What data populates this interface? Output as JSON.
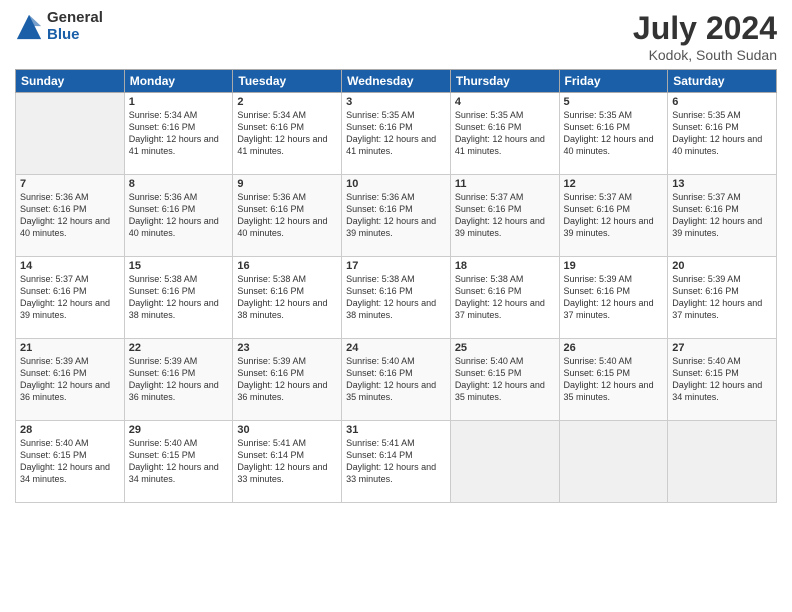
{
  "logo": {
    "general": "General",
    "blue": "Blue"
  },
  "title": "July 2024",
  "location": "Kodok, South Sudan",
  "days_of_week": [
    "Sunday",
    "Monday",
    "Tuesday",
    "Wednesday",
    "Thursday",
    "Friday",
    "Saturday"
  ],
  "weeks": [
    [
      {
        "day": "",
        "sunrise": "",
        "sunset": "",
        "daylight": ""
      },
      {
        "day": "1",
        "sunrise": "Sunrise: 5:34 AM",
        "sunset": "Sunset: 6:16 PM",
        "daylight": "Daylight: 12 hours and 41 minutes."
      },
      {
        "day": "2",
        "sunrise": "Sunrise: 5:34 AM",
        "sunset": "Sunset: 6:16 PM",
        "daylight": "Daylight: 12 hours and 41 minutes."
      },
      {
        "day": "3",
        "sunrise": "Sunrise: 5:35 AM",
        "sunset": "Sunset: 6:16 PM",
        "daylight": "Daylight: 12 hours and 41 minutes."
      },
      {
        "day": "4",
        "sunrise": "Sunrise: 5:35 AM",
        "sunset": "Sunset: 6:16 PM",
        "daylight": "Daylight: 12 hours and 41 minutes."
      },
      {
        "day": "5",
        "sunrise": "Sunrise: 5:35 AM",
        "sunset": "Sunset: 6:16 PM",
        "daylight": "Daylight: 12 hours and 40 minutes."
      },
      {
        "day": "6",
        "sunrise": "Sunrise: 5:35 AM",
        "sunset": "Sunset: 6:16 PM",
        "daylight": "Daylight: 12 hours and 40 minutes."
      }
    ],
    [
      {
        "day": "7",
        "sunrise": "Sunrise: 5:36 AM",
        "sunset": "Sunset: 6:16 PM",
        "daylight": "Daylight: 12 hours and 40 minutes."
      },
      {
        "day": "8",
        "sunrise": "Sunrise: 5:36 AM",
        "sunset": "Sunset: 6:16 PM",
        "daylight": "Daylight: 12 hours and 40 minutes."
      },
      {
        "day": "9",
        "sunrise": "Sunrise: 5:36 AM",
        "sunset": "Sunset: 6:16 PM",
        "daylight": "Daylight: 12 hours and 40 minutes."
      },
      {
        "day": "10",
        "sunrise": "Sunrise: 5:36 AM",
        "sunset": "Sunset: 6:16 PM",
        "daylight": "Daylight: 12 hours and 39 minutes."
      },
      {
        "day": "11",
        "sunrise": "Sunrise: 5:37 AM",
        "sunset": "Sunset: 6:16 PM",
        "daylight": "Daylight: 12 hours and 39 minutes."
      },
      {
        "day": "12",
        "sunrise": "Sunrise: 5:37 AM",
        "sunset": "Sunset: 6:16 PM",
        "daylight": "Daylight: 12 hours and 39 minutes."
      },
      {
        "day": "13",
        "sunrise": "Sunrise: 5:37 AM",
        "sunset": "Sunset: 6:16 PM",
        "daylight": "Daylight: 12 hours and 39 minutes."
      }
    ],
    [
      {
        "day": "14",
        "sunrise": "Sunrise: 5:37 AM",
        "sunset": "Sunset: 6:16 PM",
        "daylight": "Daylight: 12 hours and 39 minutes."
      },
      {
        "day": "15",
        "sunrise": "Sunrise: 5:38 AM",
        "sunset": "Sunset: 6:16 PM",
        "daylight": "Daylight: 12 hours and 38 minutes."
      },
      {
        "day": "16",
        "sunrise": "Sunrise: 5:38 AM",
        "sunset": "Sunset: 6:16 PM",
        "daylight": "Daylight: 12 hours and 38 minutes."
      },
      {
        "day": "17",
        "sunrise": "Sunrise: 5:38 AM",
        "sunset": "Sunset: 6:16 PM",
        "daylight": "Daylight: 12 hours and 38 minutes."
      },
      {
        "day": "18",
        "sunrise": "Sunrise: 5:38 AM",
        "sunset": "Sunset: 6:16 PM",
        "daylight": "Daylight: 12 hours and 37 minutes."
      },
      {
        "day": "19",
        "sunrise": "Sunrise: 5:39 AM",
        "sunset": "Sunset: 6:16 PM",
        "daylight": "Daylight: 12 hours and 37 minutes."
      },
      {
        "day": "20",
        "sunrise": "Sunrise: 5:39 AM",
        "sunset": "Sunset: 6:16 PM",
        "daylight": "Daylight: 12 hours and 37 minutes."
      }
    ],
    [
      {
        "day": "21",
        "sunrise": "Sunrise: 5:39 AM",
        "sunset": "Sunset: 6:16 PM",
        "daylight": "Daylight: 12 hours and 36 minutes."
      },
      {
        "day": "22",
        "sunrise": "Sunrise: 5:39 AM",
        "sunset": "Sunset: 6:16 PM",
        "daylight": "Daylight: 12 hours and 36 minutes."
      },
      {
        "day": "23",
        "sunrise": "Sunrise: 5:39 AM",
        "sunset": "Sunset: 6:16 PM",
        "daylight": "Daylight: 12 hours and 36 minutes."
      },
      {
        "day": "24",
        "sunrise": "Sunrise: 5:40 AM",
        "sunset": "Sunset: 6:16 PM",
        "daylight": "Daylight: 12 hours and 35 minutes."
      },
      {
        "day": "25",
        "sunrise": "Sunrise: 5:40 AM",
        "sunset": "Sunset: 6:15 PM",
        "daylight": "Daylight: 12 hours and 35 minutes."
      },
      {
        "day": "26",
        "sunrise": "Sunrise: 5:40 AM",
        "sunset": "Sunset: 6:15 PM",
        "daylight": "Daylight: 12 hours and 35 minutes."
      },
      {
        "day": "27",
        "sunrise": "Sunrise: 5:40 AM",
        "sunset": "Sunset: 6:15 PM",
        "daylight": "Daylight: 12 hours and 34 minutes."
      }
    ],
    [
      {
        "day": "28",
        "sunrise": "Sunrise: 5:40 AM",
        "sunset": "Sunset: 6:15 PM",
        "daylight": "Daylight: 12 hours and 34 minutes."
      },
      {
        "day": "29",
        "sunrise": "Sunrise: 5:40 AM",
        "sunset": "Sunset: 6:15 PM",
        "daylight": "Daylight: 12 hours and 34 minutes."
      },
      {
        "day": "30",
        "sunrise": "Sunrise: 5:41 AM",
        "sunset": "Sunset: 6:14 PM",
        "daylight": "Daylight: 12 hours and 33 minutes."
      },
      {
        "day": "31",
        "sunrise": "Sunrise: 5:41 AM",
        "sunset": "Sunset: 6:14 PM",
        "daylight": "Daylight: 12 hours and 33 minutes."
      },
      {
        "day": "",
        "sunrise": "",
        "sunset": "",
        "daylight": ""
      },
      {
        "day": "",
        "sunrise": "",
        "sunset": "",
        "daylight": ""
      },
      {
        "day": "",
        "sunrise": "",
        "sunset": "",
        "daylight": ""
      }
    ]
  ]
}
